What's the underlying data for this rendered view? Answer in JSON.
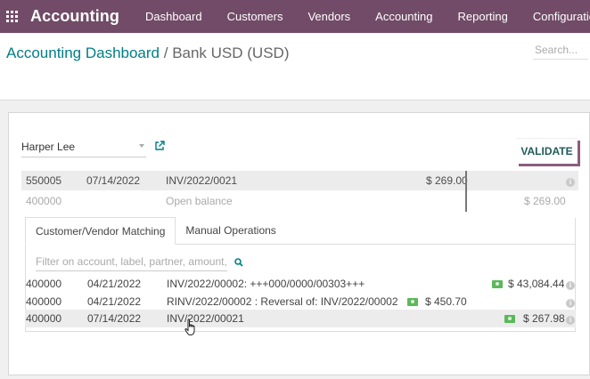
{
  "topbar": {
    "brand": "Accounting",
    "menu": [
      "Dashboard",
      "Customers",
      "Vendors",
      "Accounting",
      "Reporting",
      "Configuration"
    ]
  },
  "breadcrumb": {
    "parent": "Accounting Dashboard",
    "separator": " / ",
    "current": "Bank USD (USD)"
  },
  "search": {
    "placeholder": "Search..."
  },
  "reconcile": {
    "partner": "Harper Lee",
    "validate_label": "VALIDATE",
    "statement_line": {
      "account": "550005",
      "date": "07/14/2022",
      "label": "INV/2022/0021",
      "amount": "$ 269.00"
    },
    "open_balance": {
      "account": "400000",
      "label": "Open balance",
      "amount": "$ 269.00"
    },
    "tabs": [
      "Customer/Vendor Matching",
      "Manual Operations"
    ],
    "filter_placeholder": "Filter on account, label, partner, amount,...",
    "proposals": [
      {
        "account": "400000",
        "date": "04/21/2022",
        "label": "INV/2022/00002: +++000/0000/00303+++",
        "debit": "",
        "credit": "$ 43,084.44"
      },
      {
        "account": "400000",
        "date": "04/21/2022",
        "label": "RINV/2022/00002 : Reversal of: INV/2022/00002",
        "debit": "$ 450.70",
        "credit": ""
      },
      {
        "account": "400000",
        "date": "07/14/2022",
        "label": "INV/2022/00021",
        "debit": "",
        "credit": "$ 267.98"
      }
    ]
  },
  "colors": {
    "topbar": "#714b67",
    "link": "#017e84",
    "validate_shadow": "#8a5d7f",
    "money": "#5cb85c"
  }
}
